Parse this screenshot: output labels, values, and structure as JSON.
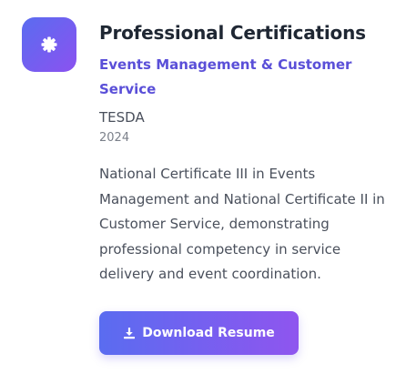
{
  "certification": {
    "section_title": "Professional Certifications",
    "name": "Events Management & Customer Service",
    "issuer": "TESDA",
    "year": "2024",
    "description": "National Certificate III in Events Management and National Certificate II in Customer Service, demonstrating professional competency in service delivery and event coordination.",
    "icon": "certificate-icon"
  },
  "actions": {
    "download_label": "Download Resume",
    "download_icon": "download-icon"
  },
  "colors": {
    "accent": "#5a4fd8",
    "gradient_start": "#5a6cf0",
    "gradient_end": "#8f55ef"
  }
}
